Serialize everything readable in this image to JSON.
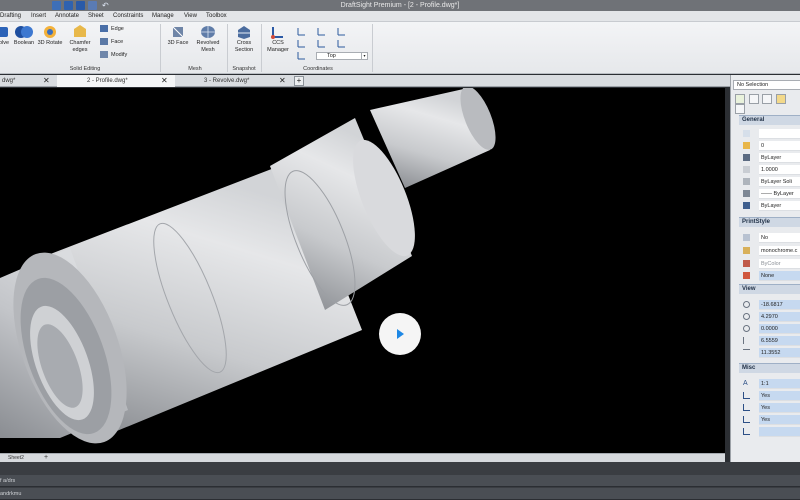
{
  "titlebar": {
    "title": "DraftSight Premium - [2 - Profile.dwg*]"
  },
  "menu": [
    "Drafting",
    "Insert",
    "Annotate",
    "Sheet",
    "Constraints",
    "Manage",
    "View",
    "Toolbox"
  ],
  "ribbon": {
    "solid_editing": {
      "label": "Solid Editing",
      "buttons": {
        "solve": "olve",
        "boolean": "Boolean",
        "rotate3d": "3D Rotate",
        "chamfer": "Chamfer",
        "chamfer2": "edges"
      },
      "small": {
        "edge": "Edge",
        "face": "Face",
        "modify": "Modify"
      }
    },
    "mesh": {
      "label": "Mesh",
      "face3d": "3D Face",
      "revolved": "Revolved",
      "revolved2": "Mesh"
    },
    "snapshot": {
      "label": "Snapshot",
      "cross": "Cross",
      "cross2": "Section"
    },
    "coordinates": {
      "label": "Coordinates",
      "ccs": "CCS",
      "ccs2": "Manager",
      "view_value": "Top"
    }
  },
  "doctabs": [
    {
      "label": "dwg*"
    },
    {
      "label": "2 - Profile.dwg*"
    },
    {
      "label": "3 - Revolve.dwg*"
    }
  ],
  "doctab_add": "+",
  "layout_tabs": {
    "sheet": "Sheet2",
    "add": "+"
  },
  "command": {
    "line1": "f a/drs",
    "line2": "andrkmu"
  },
  "properties": {
    "selection": "No Selection",
    "general": {
      "title": "General",
      "values": [
        "",
        "0",
        "ByLayer",
        "1.0000",
        "ByLayer    Soli",
        "—— ByLayer",
        "ByLayer"
      ]
    },
    "printstyle": {
      "title": "PrintStyle",
      "values": [
        "No",
        "monochrome.c",
        "ByColor",
        "None"
      ]
    },
    "view": {
      "title": "View",
      "values": [
        "-18.6817",
        "4.2970",
        "0.0000",
        "6.5559",
        "11.3552"
      ]
    },
    "misc": {
      "title": "Misc",
      "values": [
        "1:1",
        "Yes",
        "Yes",
        "Yes",
        ""
      ]
    }
  },
  "colors": {
    "accent": "#1e88e5",
    "viewport_bg": "#000000",
    "panel_section": "#cfd8e4"
  }
}
